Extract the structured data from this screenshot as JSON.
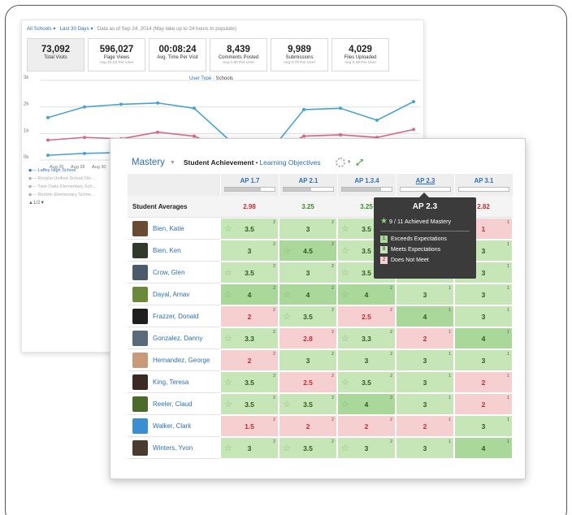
{
  "colors": {
    "link": "#2e6fb4",
    "exceeds": "#a9d89a",
    "meets": "#c6e6b8",
    "not_meet": "#f6cfd1",
    "red_text": "#cc2b2b",
    "series_blue": "#4aa3cc",
    "series_pink": "#d36b8e"
  },
  "analytics": {
    "filters": {
      "schools": "All Schools ▾",
      "range": "Last 30 Days ▾",
      "note": "Data as of Sep 24, 2014 (May take up to 24 hours to populate)"
    },
    "stats": [
      {
        "value": "73,092",
        "label": "Total Visits",
        "sub": ""
      },
      {
        "value": "596,027",
        "label": "Page Views",
        "sub": "Avg 42.03 Per User"
      },
      {
        "value": "00:08:24",
        "label": "Avg. Time Per Visit",
        "sub": ""
      },
      {
        "value": "8,439",
        "label": "Comments Posted",
        "sub": "Avg 0.60 Per User"
      },
      {
        "value": "9,989",
        "label": "Submissions",
        "sub": "Avg 0.70 Per User"
      },
      {
        "value": "4,029",
        "label": "Files Uploaded",
        "sub": "Avg 0.28 Per User"
      }
    ],
    "legend_toggle": {
      "user_type": "User Type",
      "sep": " · ",
      "schools": "Schools"
    },
    "chart_data": {
      "type": "line",
      "y_ticks": [
        "3k",
        "2k",
        "1k",
        "0k"
      ],
      "ylim": [
        0,
        3000
      ],
      "categories": [
        "Aug 26",
        "Aug 28",
        "Aug 30"
      ],
      "series": [
        {
          "name": "Laffey High School",
          "color": "#4aa3cc",
          "values": [
            1600,
            2000,
            2100,
            2150,
            1950,
            700,
            200,
            1900,
            1950,
            1500,
            2200
          ]
        },
        {
          "name": "",
          "color": "#d36b8e",
          "values": [
            750,
            850,
            800,
            1050,
            900,
            350,
            150,
            900,
            950,
            850,
            1150
          ]
        },
        {
          "name": "",
          "color": "#4aa3cc",
          "values": [
            180,
            250,
            280,
            280,
            420,
            180,
            100,
            240,
            260,
            200,
            300
          ]
        }
      ]
    },
    "legend_items": [
      "Laffey High School",
      "Rocklin Unified School Dis…",
      "Twin Oaks Elementary Sch…",
      "Rocklin Elementary Schoo…"
    ],
    "pager": "1/2"
  },
  "mastery": {
    "title": "Mastery",
    "achievement": "Student Achievement",
    "dot": "•",
    "objectives_link": "Learning Objectives",
    "averages_label": "Student Averages",
    "columns": [
      {
        "label": "AP 1.7",
        "avg": "2.98",
        "avg_status": "r",
        "fill": 0.72
      },
      {
        "label": "AP 2.1",
        "avg": "3.25",
        "avg_status": "g",
        "fill": 0.55
      },
      {
        "label": "AP 1.3.4",
        "avg": "3.25",
        "avg_status": "g",
        "fill": 0.78
      },
      {
        "label": "AP 2.3",
        "avg": "",
        "avg_status": "g",
        "fill": 0.0
      },
      {
        "label": "AP 3.1",
        "avg": "2.82",
        "avg_status": "r",
        "fill": 0.0
      }
    ],
    "students": [
      {
        "name": "Bien, Katie",
        "avatar": "#6b4a33",
        "cells": [
          {
            "v": "3.5",
            "s": "g1",
            "star": true,
            "n": "2"
          },
          {
            "v": "3",
            "s": "g1",
            "star": false,
            "n": "2"
          },
          {
            "v": "3.5",
            "s": "g1",
            "star": true,
            "n": "2"
          },
          {
            "v": "3",
            "s": "g1",
            "star": false,
            "n": "1"
          },
          {
            "v": "1",
            "s": "r",
            "star": false,
            "n": "1"
          }
        ]
      },
      {
        "name": "Bien, Ken",
        "avatar": "#2f3a2a",
        "cells": [
          {
            "v": "3",
            "s": "g1",
            "star": false,
            "n": "2"
          },
          {
            "v": "4.5",
            "s": "g2",
            "star": true,
            "n": "2"
          },
          {
            "v": "3.5",
            "s": "g1",
            "star": true,
            "n": "2"
          },
          {
            "v": "3",
            "s": "g1",
            "star": false,
            "n": "1"
          },
          {
            "v": "3",
            "s": "g1",
            "star": false,
            "n": "1"
          }
        ]
      },
      {
        "name": "Crow, Glen",
        "avatar": "#4a5a6a",
        "cells": [
          {
            "v": "3.5",
            "s": "g1",
            "star": true,
            "n": "2"
          },
          {
            "v": "3",
            "s": "g1",
            "star": false,
            "n": "2"
          },
          {
            "v": "3.5",
            "s": "g1",
            "star": true,
            "n": "2"
          },
          {
            "v": "3",
            "s": "g1",
            "star": false,
            "n": "1"
          },
          {
            "v": "3",
            "s": "g1",
            "star": false,
            "n": "1"
          }
        ]
      },
      {
        "name": "Dayal, Arnav",
        "avatar": "#6a8a3a",
        "cells": [
          {
            "v": "4",
            "s": "g2",
            "star": true,
            "n": "2"
          },
          {
            "v": "4",
            "s": "g2",
            "star": true,
            "n": "2"
          },
          {
            "v": "4",
            "s": "g2",
            "star": true,
            "n": "2"
          },
          {
            "v": "3",
            "s": "g1",
            "star": false,
            "n": "1"
          },
          {
            "v": "3",
            "s": "g1",
            "star": false,
            "n": "1"
          }
        ]
      },
      {
        "name": "Frazzer, Donald",
        "avatar": "#1e1e1e",
        "cells": [
          {
            "v": "2",
            "s": "r",
            "star": false,
            "n": "2"
          },
          {
            "v": "3.5",
            "s": "g1",
            "star": true,
            "n": "2"
          },
          {
            "v": "2.5",
            "s": "r",
            "star": false,
            "n": "2"
          },
          {
            "v": "4",
            "s": "g2",
            "star": false,
            "n": "1"
          },
          {
            "v": "3",
            "s": "g1",
            "star": false,
            "n": "1"
          }
        ]
      },
      {
        "name": "Gonzalez, Danny",
        "avatar": "#5a6a7a",
        "cells": [
          {
            "v": "3.3",
            "s": "g1",
            "star": true,
            "n": "2"
          },
          {
            "v": "2.8",
            "s": "r",
            "star": false,
            "n": "2"
          },
          {
            "v": "3.3",
            "s": "g1",
            "star": true,
            "n": "2"
          },
          {
            "v": "2",
            "s": "r",
            "star": false,
            "n": "1"
          },
          {
            "v": "4",
            "s": "g2",
            "star": false,
            "n": "1"
          }
        ]
      },
      {
        "name": "Hernandez, George",
        "avatar": "#c99a7a",
        "cells": [
          {
            "v": "2",
            "s": "r",
            "star": false,
            "n": "2"
          },
          {
            "v": "3",
            "s": "g1",
            "star": false,
            "n": "2"
          },
          {
            "v": "3",
            "s": "g1",
            "star": false,
            "n": "2"
          },
          {
            "v": "3",
            "s": "g1",
            "star": false,
            "n": "1"
          },
          {
            "v": "3",
            "s": "g1",
            "star": false,
            "n": "1"
          }
        ]
      },
      {
        "name": "King, Teresa",
        "avatar": "#3a2a22",
        "cells": [
          {
            "v": "3.5",
            "s": "g1",
            "star": true,
            "n": "2"
          },
          {
            "v": "2.5",
            "s": "r",
            "star": false,
            "n": "2"
          },
          {
            "v": "3.5",
            "s": "g1",
            "star": true,
            "n": "2"
          },
          {
            "v": "3",
            "s": "g1",
            "star": false,
            "n": "1"
          },
          {
            "v": "2",
            "s": "r",
            "star": false,
            "n": "1"
          }
        ]
      },
      {
        "name": "Reeler, Claud",
        "avatar": "#4a6a2a",
        "cells": [
          {
            "v": "3.5",
            "s": "g1",
            "star": true,
            "n": "2"
          },
          {
            "v": "3.5",
            "s": "g1",
            "star": true,
            "n": "2"
          },
          {
            "v": "4",
            "s": "g2",
            "star": true,
            "n": "2"
          },
          {
            "v": "3",
            "s": "g1",
            "star": false,
            "n": "1"
          },
          {
            "v": "2",
            "s": "r",
            "star": false,
            "n": "1"
          }
        ]
      },
      {
        "name": "Walker, Clark",
        "avatar": "#3b8fd0",
        "cells": [
          {
            "v": "1.5",
            "s": "r",
            "star": false,
            "n": "2"
          },
          {
            "v": "2",
            "s": "r",
            "star": false,
            "n": "2"
          },
          {
            "v": "2",
            "s": "r",
            "star": false,
            "n": "2"
          },
          {
            "v": "2",
            "s": "r",
            "star": false,
            "n": "1"
          },
          {
            "v": "3",
            "s": "g1",
            "star": false,
            "n": "1"
          }
        ]
      },
      {
        "name": "Winters, Yvon",
        "avatar": "#4a3a30",
        "cells": [
          {
            "v": "3",
            "s": "g1",
            "star": true,
            "n": "2"
          },
          {
            "v": "3.5",
            "s": "g1",
            "star": true,
            "n": "2"
          },
          {
            "v": "3",
            "s": "g1",
            "star": true,
            "n": "2"
          },
          {
            "v": "3",
            "s": "g1",
            "star": false,
            "n": "1"
          },
          {
            "v": "4",
            "s": "g2",
            "star": false,
            "n": "1"
          }
        ]
      }
    ],
    "tooltip": {
      "title": "AP 2.3",
      "summary": "9 / 11 Achieved Mastery",
      "items": [
        {
          "count": "1",
          "label": "Exceeds Expectations",
          "color": "#a9d89a"
        },
        {
          "count": "8",
          "label": "Meets Expectations",
          "color": "#c6e6b8"
        },
        {
          "count": "2",
          "label": "Does Not Meet",
          "color": "#f6cfd1"
        }
      ]
    }
  }
}
